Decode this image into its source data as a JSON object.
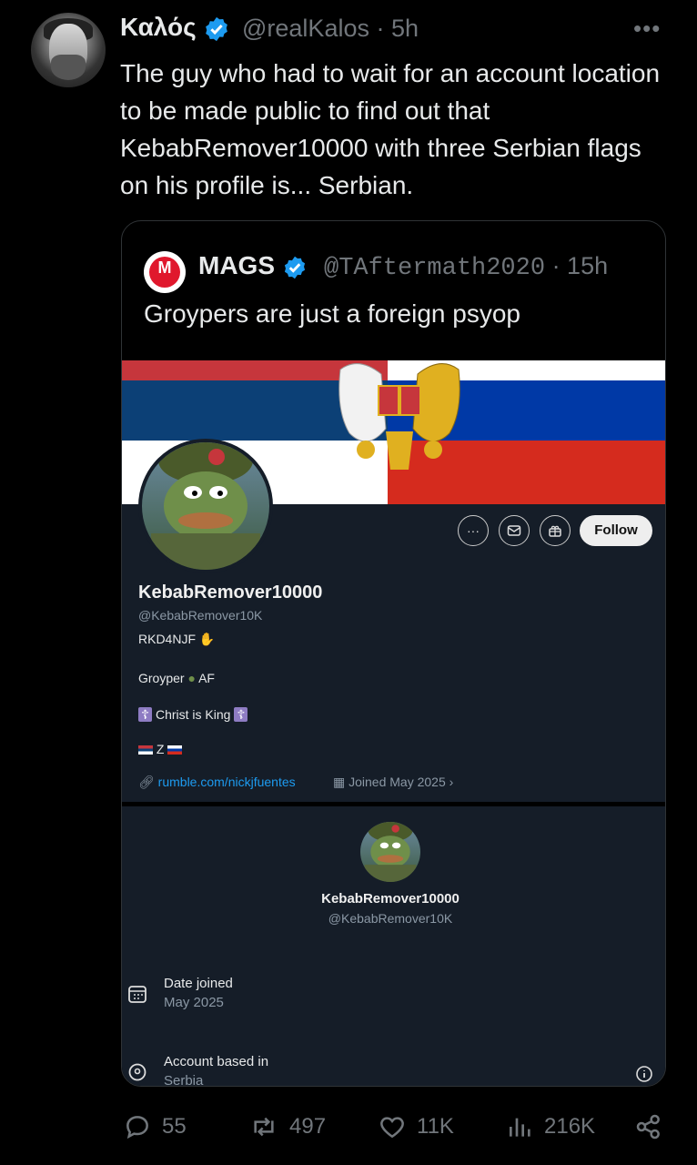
{
  "tweet": {
    "author_name": "Καλός",
    "handle": "@realKalos",
    "time": "· 5h",
    "more": "•••",
    "text": "The guy who had to wait for an account location to be made public to find out that KebabRemover10000 with three Serbian flags on his profile is... Serbian."
  },
  "quote": {
    "author_name": "MAGS",
    "handle": "@TAftermath2020",
    "time": "· 15h",
    "text": "Groypers are just a foreign psyop",
    "avatar_letter": "M"
  },
  "profile": {
    "name": "KebabRemover10000",
    "handle": "@KebabRemover10K",
    "follow_label": "Follow",
    "more_label": "···",
    "bio_line1": "RKD4NJF",
    "bio_line2a": "Groyper",
    "bio_line2b": "AF",
    "bio_line3": "Christ is King",
    "bio_line4": "Z",
    "link": "rumble.com/nickjfuentes",
    "joined": "Joined May 2025"
  },
  "about": {
    "name": "KebabRemover10000",
    "handle": "@KebabRemover10K",
    "date_label": "Date joined",
    "date_value": "May 2025",
    "location_label": "Account based in",
    "location_value": "Serbia"
  },
  "actions": {
    "replies": "55",
    "reposts": "497",
    "likes": "11K",
    "views": "216K"
  },
  "colors": {
    "verified": "#1d9bf0",
    "serbia_red": "#c6363c",
    "serbia_blue": "#0c4076",
    "russia_blue": "#0039a6",
    "russia_red": "#d52b1e"
  }
}
